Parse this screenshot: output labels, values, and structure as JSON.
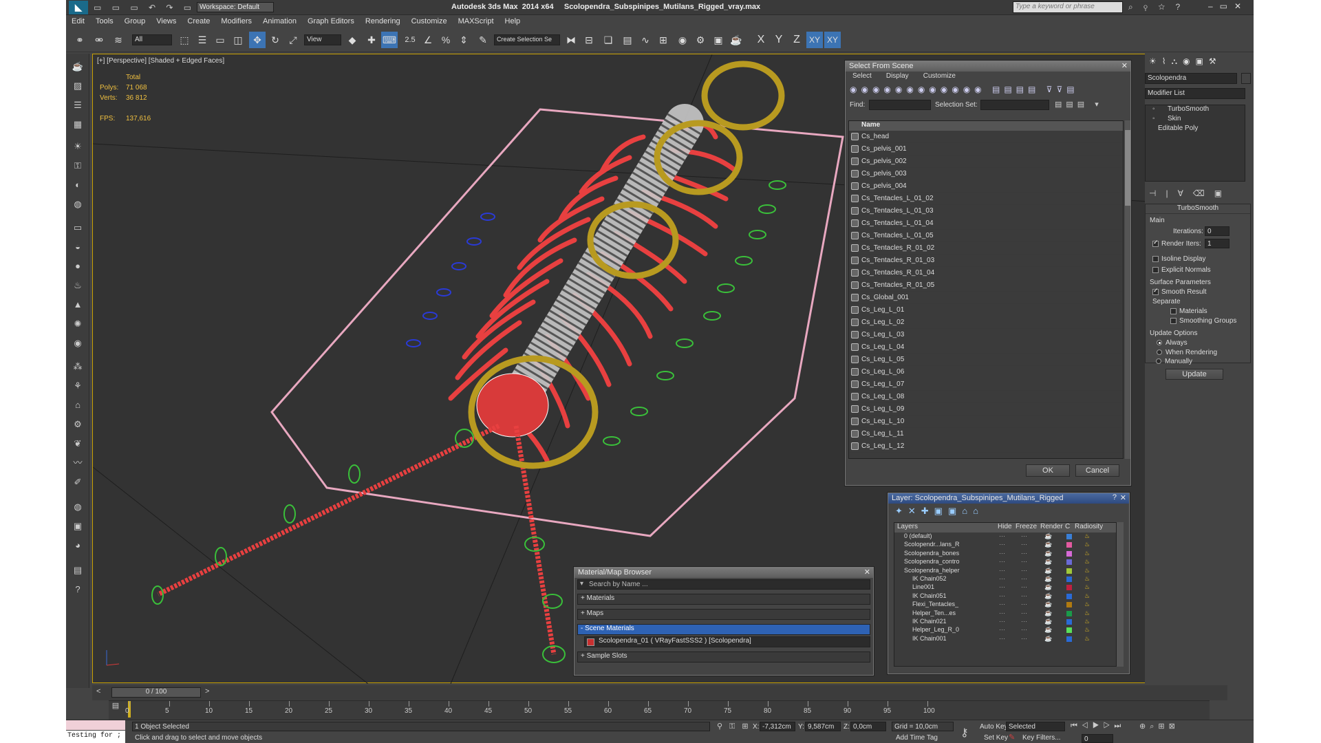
{
  "app": {
    "title": "Autodesk 3ds Max  2014 x64     Scolopendra_Subspinipes_Mutilans_Rigged_vray.max",
    "workspace": "Workspace: Default",
    "search_placeholder": "Type a keyword or phrase"
  },
  "menu": [
    "Edit",
    "Tools",
    "Group",
    "Views",
    "Create",
    "Modifiers",
    "Animation",
    "Graph Editors",
    "Rendering",
    "Customize",
    "MAXScript",
    "Help"
  ],
  "toolbar": {
    "filter": "All",
    "view": "View",
    "snap_label": "2.5",
    "selection_set": "Create Selection Se",
    "axis_x": "X",
    "axis_y": "Y",
    "axis_z": "Z",
    "axis_xy": "XY",
    "axis_xy2": "XY"
  },
  "viewport": {
    "label": "[+] [Perspective] [Shaded + Edged Faces]",
    "stats_total": "Total",
    "polys_label": "Polys:",
    "polys_value": "71 068",
    "verts_label": "Verts:",
    "verts_value": "36 812",
    "fps_label": "FPS:",
    "fps_value": "137,616"
  },
  "select_from_scene": {
    "title": "Select From Scene",
    "menus": [
      "Select",
      "Display",
      "Customize"
    ],
    "find_label": "Find:",
    "selection_set_label": "Selection Set:",
    "column_name": "Name",
    "items": [
      "Cs_head",
      "Cs_pelvis_001",
      "Cs_pelvis_002",
      "Cs_pelvis_003",
      "Cs_pelvis_004",
      "Cs_Tentacles_L_01_02",
      "Cs_Tentacles_L_01_03",
      "Cs_Tentacles_L_01_04",
      "Cs_Tentacles_L_01_05",
      "Cs_Tentacles_R_01_02",
      "Cs_Tentacles_R_01_03",
      "Cs_Tentacles_R_01_04",
      "Cs_Tentacles_R_01_05",
      "Cs_Global_001",
      "Cs_Leg_L_01",
      "Cs_Leg_L_02",
      "Cs_Leg_L_03",
      "Cs_Leg_L_04",
      "Cs_Leg_L_05",
      "Cs_Leg_L_06",
      "Cs_Leg_L_07",
      "Cs_Leg_L_08",
      "Cs_Leg_L_09",
      "Cs_Leg_L_10",
      "Cs_Leg_L_11",
      "Cs_Leg_L_12"
    ],
    "ok": "OK",
    "cancel": "Cancel"
  },
  "command_panel": {
    "object_name": "Scolopendra",
    "modifier_list": "Modifier List",
    "stack": [
      "TurboSmooth",
      "Skin",
      "Editable Poly"
    ],
    "rollout_title": "TurboSmooth",
    "main": "Main",
    "iterations_label": "Iterations:",
    "iterations_value": "0",
    "render_iters_label": "Render Iters:",
    "render_iters_value": "1",
    "isoline": "Isoline Display",
    "explicit_normals": "Explicit Normals",
    "surface_params": "Surface Parameters",
    "smooth_result": "Smooth Result",
    "separate": "Separate",
    "materials": "Materials",
    "smoothing_groups": "Smoothing Groups",
    "update_options": "Update Options",
    "always": "Always",
    "when_rendering": "When Rendering",
    "manually": "Manually",
    "update": "Update",
    "color": "#5ad6b8"
  },
  "layer_dialog": {
    "title": "Layer: Scolopendra_Subspinipes_Mutilans_Rigged",
    "headers": [
      "Layers",
      "Hide",
      "Freeze",
      "Render",
      "C",
      "Radiosity"
    ],
    "rows": [
      {
        "name": "0 (default)",
        "color": "#3a7fd6"
      },
      {
        "name": "Scolopendr...lans_R",
        "color": "#e35aa0"
      },
      {
        "name": "Scolopendra_bones",
        "color": "#d66ad6"
      },
      {
        "name": "Scolopendra_contro",
        "color": "#6a6ad6"
      },
      {
        "name": "Scolopendra_helper",
        "color": "#a0c83a"
      },
      {
        "name": "IK Chain052",
        "color": "#2a6ad6"
      },
      {
        "name": "Line001",
        "color": "#c02040"
      },
      {
        "name": "IK Chain051",
        "color": "#2a6ad6"
      },
      {
        "name": "Flexi_Tentacles_",
        "color": "#b07a10"
      },
      {
        "name": "Helper_Ten...es",
        "color": "#1a9a4a"
      },
      {
        "name": "IK Chain021",
        "color": "#2a6ad6"
      },
      {
        "name": "Helper_Leg_R_0",
        "color": "#5ae05a"
      },
      {
        "name": "IK Chain001",
        "color": "#2a6ad6"
      }
    ]
  },
  "material_browser": {
    "title": "Material/Map Browser",
    "search_placeholder": "Search by Name ...",
    "groups": [
      "+ Materials",
      "+ Maps",
      "- Scene Materials"
    ],
    "scene_material": "Scolopendra_01  ( VRayFastSSS2 )  [Scolopendra]",
    "sample_slots": "+ Sample Slots"
  },
  "timeline": {
    "position": "0 / 100",
    "ticks": [
      "0",
      "5",
      "10",
      "15",
      "20",
      "25",
      "30",
      "35",
      "40",
      "45",
      "50",
      "55",
      "60",
      "65",
      "70",
      "75",
      "80",
      "85",
      "90",
      "95",
      "100"
    ]
  },
  "status": {
    "script_listener": "Testing for ;",
    "selected": "1 Object Selected",
    "prompt": "Click and drag to select and move objects",
    "x_label": "X:",
    "x_value": "-7,312cm",
    "y_label": "Y:",
    "y_value": "9,587cm",
    "z_label": "Z:",
    "z_value": "0,0cm",
    "grid": "Grid = 10,0cm",
    "add_time_tag": "Add Time Tag",
    "auto_key": "Auto Key",
    "set_key": "Set Key",
    "selected_dropdown": "Selected",
    "key_filters": "Key Filters...",
    "frame": "0"
  }
}
